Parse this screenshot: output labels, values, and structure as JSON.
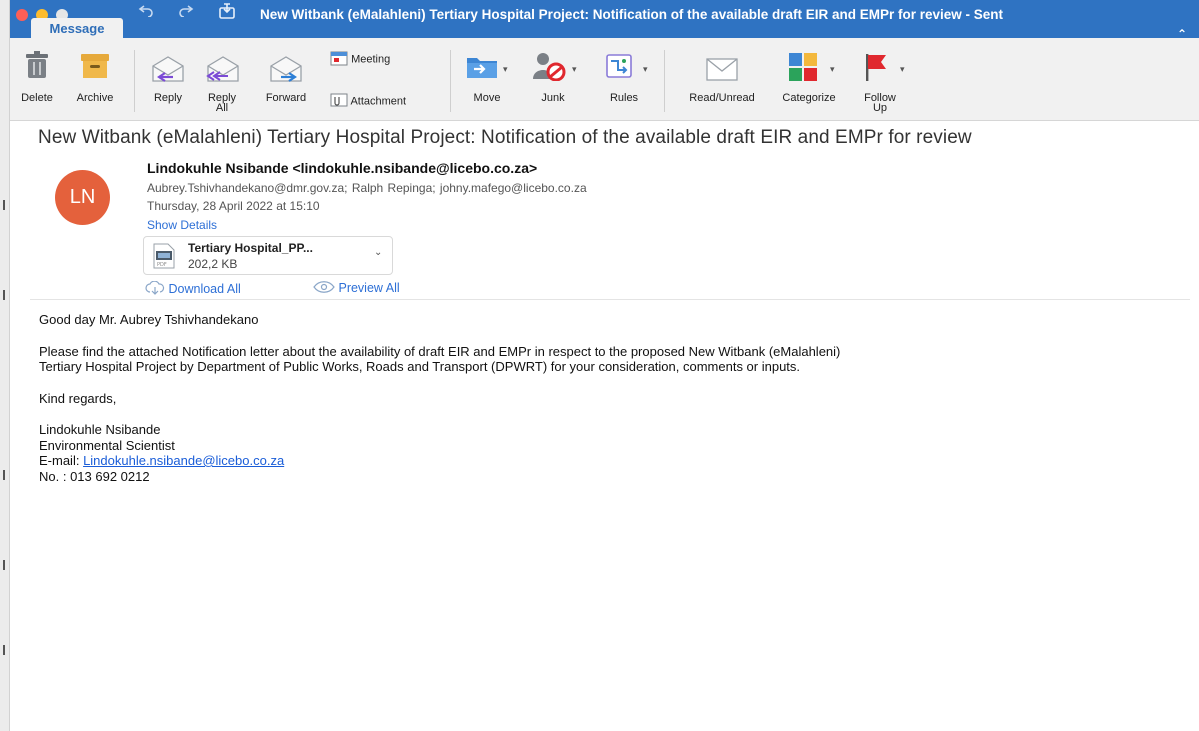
{
  "window": {
    "title": "New Witbank (eMalahleni) Tertiary Hospital Project: Notification of the available draft EIR and EMPr for review - Sent",
    "tab": "Message"
  },
  "ribbon": {
    "delete": "Delete",
    "archive": "Archive",
    "reply": "Reply",
    "reply_all": "Reply All",
    "forward": "Forward",
    "meeting": "Meeting",
    "attachment": "Attachment",
    "move": "Move",
    "junk": "Junk",
    "rules": "Rules",
    "read_unread": "Read/Unread",
    "categorize": "Categorize",
    "follow_up": "Follow Up"
  },
  "message": {
    "subject": "New Witbank (eMalahleni) Tertiary Hospital Project: Notification of the available draft EIR and EMPr for review",
    "avatar_initials": "LN",
    "from": "Lindokuhle Nsibande <lindokuhle.nsibande@licebo.co.za>",
    "to": "Aubrey.Tshivhandekano@dmr.gov.za;  Ralph Repinga;  johny.mafego@licebo.co.za",
    "date": "Thursday, 28 April 2022 at 15:10",
    "show_details": "Show Details",
    "attachment": {
      "name": "Tertiary Hospital_PP...",
      "size": "202,2 KB"
    },
    "download_all": "Download All",
    "preview_all": "Preview All"
  },
  "body": {
    "greeting": "Good day Mr. Aubrey Tshivhandekano",
    "paragraph_line1": "Please find the attached Notification letter about the availability of draft EIR and EMPr in respect to the proposed New Witbank (eMalahleni)",
    "paragraph_line2": "Tertiary Hospital Project by Department of Public Works, Roads and Transport (DPWRT) for your consideration, comments or inputs.",
    "closing": "Kind regards,",
    "sig_name": "Lindokuhle Nsibande",
    "sig_title": "Environmental Scientist",
    "sig_email_label": "E-mail: ",
    "sig_email": "Lindokuhle.nsibande@licebo.co.za",
    "sig_phone": "No. : 013 692 0212"
  },
  "colors": {
    "titlebar": "#2f73c2",
    "avatar": "#e4613c",
    "link": "#2d6fd6",
    "flag": "#e0282e"
  }
}
